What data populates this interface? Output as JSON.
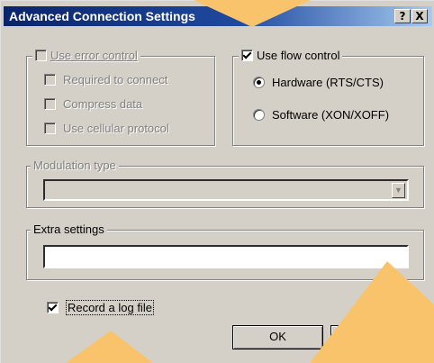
{
  "window": {
    "title": "Advanced Connection Settings"
  },
  "titlebar_buttons": {
    "help": "?",
    "close": "X"
  },
  "error_control": {
    "label": "Use error control",
    "checked": false,
    "enabled": false,
    "options": [
      {
        "label": "Required to connect",
        "checked": false
      },
      {
        "label": "Compress data",
        "checked": false
      },
      {
        "label": "Use cellular protocol",
        "checked": false
      }
    ]
  },
  "flow_control": {
    "label": "Use flow control",
    "checked": true,
    "options": [
      {
        "label": "Hardware (RTS/CTS)",
        "selected": true
      },
      {
        "label": "Software (XON/XOFF)",
        "selected": false
      }
    ]
  },
  "modulation": {
    "label": "Modulation type",
    "value": "",
    "enabled": false
  },
  "extra_settings": {
    "label": "Extra settings",
    "value": ""
  },
  "log_file": {
    "label": "Record a log file",
    "checked": true
  },
  "buttons": {
    "ok": "OK"
  },
  "colors": {
    "background_overlay": "#f7cf7e",
    "arrow": "#f9c36b",
    "title_start": "#0a246a",
    "title_end": "#a6caf0"
  }
}
